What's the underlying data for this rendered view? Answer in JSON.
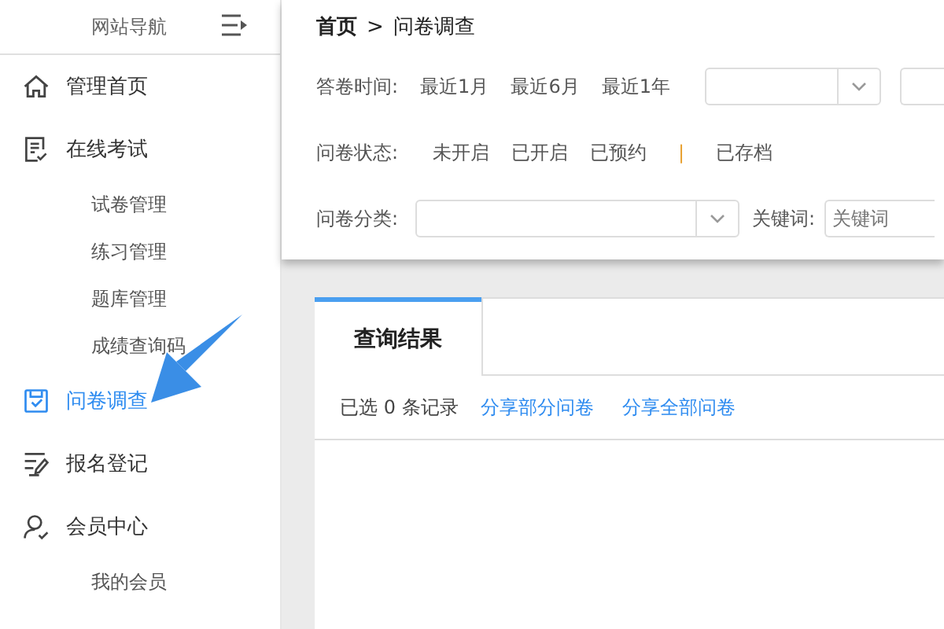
{
  "sidebar": {
    "title": "网站导航",
    "items": [
      {
        "kind": "home",
        "label": "管理首页",
        "selected": false
      },
      {
        "kind": "exam",
        "label": "在线考试",
        "selected": false,
        "children": [
          {
            "label": "试卷管理"
          },
          {
            "label": "练习管理"
          },
          {
            "label": "题库管理"
          },
          {
            "label": "成绩查询码"
          }
        ]
      },
      {
        "kind": "survey",
        "label": "问卷调查",
        "selected": true
      },
      {
        "kind": "register",
        "label": "报名登记",
        "selected": false
      },
      {
        "kind": "member",
        "label": "会员中心",
        "selected": false,
        "children": [
          {
            "label": "我的会员"
          }
        ]
      }
    ]
  },
  "breadcrumb": {
    "home": "首页",
    "separator": ">",
    "current": "问卷调查"
  },
  "filters": {
    "time": {
      "label": "答卷时间:",
      "options": [
        "最近1月",
        "最近6月",
        "最近1年"
      ]
    },
    "status": {
      "label": "问卷状态:",
      "options": [
        "未开启",
        "已开启",
        "已预约"
      ],
      "divider": "|",
      "archived": "已存档"
    },
    "category": {
      "label": "问卷分类:"
    },
    "keyword": {
      "label": "关键词:",
      "placeholder": "关键词"
    }
  },
  "results": {
    "tab": "查询结果",
    "summary": "已选 0 条记录",
    "actions": [
      "分享部分问卷",
      "分享全部问卷"
    ]
  }
}
